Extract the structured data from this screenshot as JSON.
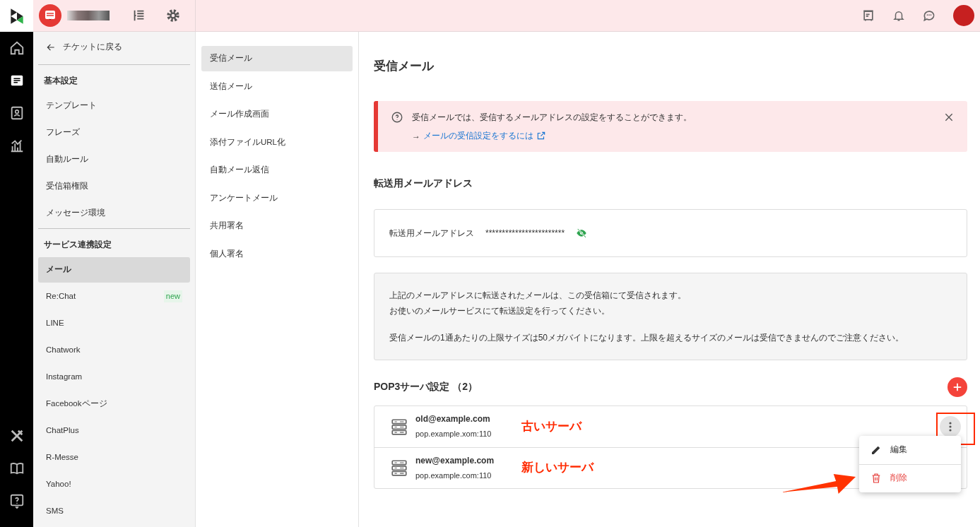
{
  "rail_items": [
    {
      "kind": "home",
      "selected": false
    },
    {
      "kind": "ticket",
      "selected": true
    },
    {
      "kind": "contacts",
      "selected": false
    },
    {
      "kind": "chart",
      "selected": false
    }
  ],
  "rail_bottom": [
    {
      "kind": "tools"
    },
    {
      "kind": "book"
    },
    {
      "kind": "help"
    }
  ],
  "sidebar": {
    "back_link": "チケットに戻る",
    "sections": [
      {
        "title": "基本設定",
        "items": [
          {
            "label": "テンプレート",
            "selected": false
          },
          {
            "label": "フレーズ",
            "selected": false
          },
          {
            "label": "自動ルール",
            "selected": false
          },
          {
            "label": "受信箱権限",
            "selected": false
          },
          {
            "label": "メッセージ環境",
            "selected": false
          }
        ]
      },
      {
        "title": "サービス連携設定",
        "items": [
          {
            "label": "メール",
            "selected": true
          },
          {
            "label": "Re:Chat",
            "selected": false,
            "badge": "new"
          },
          {
            "label": "LINE",
            "selected": false
          },
          {
            "label": "Chatwork",
            "selected": false
          },
          {
            "label": "Instagram",
            "selected": false
          },
          {
            "label": "Facebookページ",
            "selected": false
          },
          {
            "label": "ChatPlus",
            "selected": false
          },
          {
            "label": "R-Messe",
            "selected": false
          },
          {
            "label": "Yahoo!",
            "selected": false
          },
          {
            "label": "SMS",
            "selected": false
          }
        ]
      }
    ]
  },
  "subnav": [
    {
      "label": "受信メール",
      "selected": true
    },
    {
      "label": "送信メール",
      "selected": false
    },
    {
      "label": "メール作成画面",
      "selected": false
    },
    {
      "label": "添付ファイルURL化",
      "selected": false
    },
    {
      "label": "自動メール返信",
      "selected": false
    },
    {
      "label": "アンケートメール",
      "selected": false
    },
    {
      "label": "共用署名",
      "selected": false
    },
    {
      "label": "個人署名",
      "selected": false
    }
  ],
  "page": {
    "title": "受信メール",
    "alert": {
      "message": "受信メールでは、受信するメールアドレスの設定をすることができます。",
      "arrow": "→",
      "link": "メールの受信設定をするには"
    },
    "forward": {
      "heading": "転送用メールアドレス",
      "label": "転送用メールアドレス",
      "value": "************************"
    },
    "info": [
      [
        "上記のメールアドレスに転送されたメールは、この受信箱にて受信されます。",
        "お使いのメールサービスにて転送設定を行ってください。"
      ],
      [
        "受信メールの1通あたりの上限サイズは50メガバイトになります。上限を超えるサイズのメールは受信できませんのでご注意ください。"
      ]
    ],
    "pop3": {
      "heading": "POP3サーバ設定 （2）",
      "servers": [
        {
          "email": "old@example.com",
          "host": "pop.example.xom:110",
          "note": "古いサーバ"
        },
        {
          "email": "new@example.com",
          "host": "pop.example.com:110",
          "note": "新しいサーバ"
        }
      ],
      "menu": [
        {
          "kind": "edit",
          "label": "編集"
        },
        {
          "kind": "delete",
          "label": "削除"
        }
      ]
    }
  }
}
